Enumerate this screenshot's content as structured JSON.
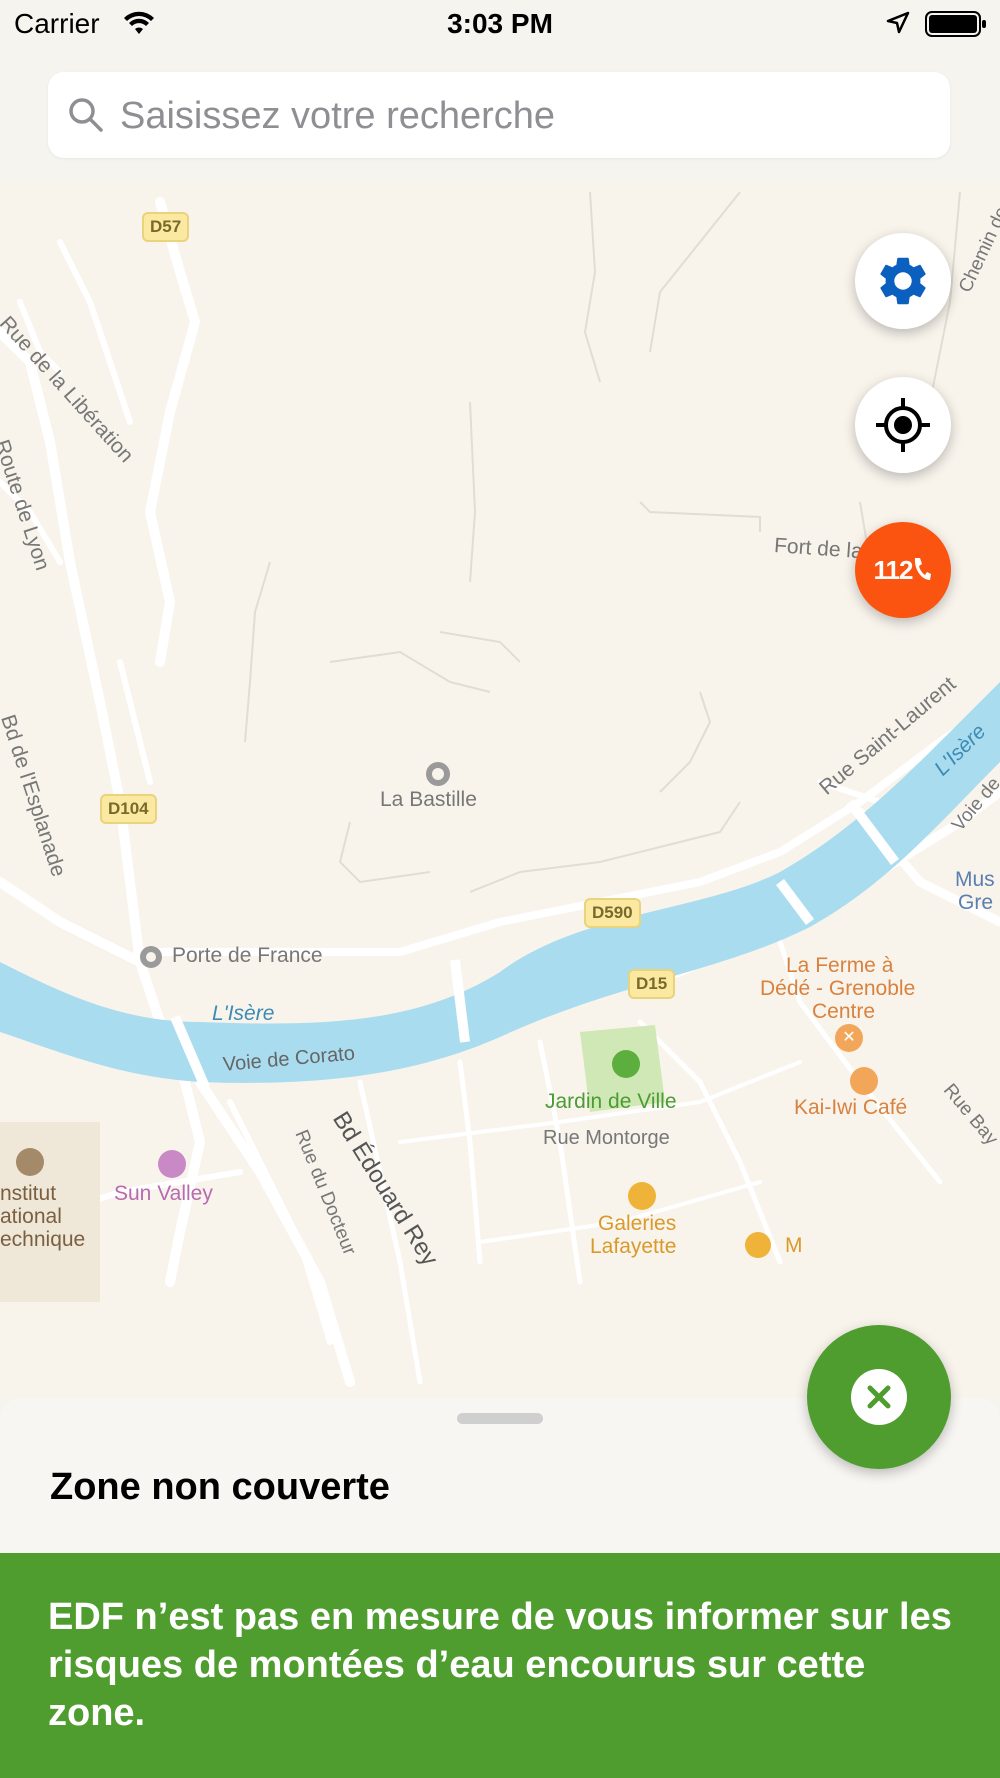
{
  "status_bar": {
    "carrier": "Carrier",
    "time": "3:03 PM"
  },
  "search": {
    "placeholder": "Saisissez votre recherche",
    "value": ""
  },
  "map": {
    "road_shields": [
      "D57",
      "D104",
      "D590",
      "D15"
    ],
    "street_labels": [
      "Rue de la Libération",
      "Route de Lyon",
      "Bd de l'Esplanade",
      "Rue Saint-Laurent",
      "Voie de Corato",
      "Bd Édouard Rey",
      "Rue du Docteur",
      "Rue Montorge",
      "Rue Bay",
      "Voie de",
      "Chemin de"
    ],
    "places": {
      "fort": "Fort de la Bastille",
      "bastille": "La Bastille",
      "porte": "Porte de France",
      "river1": "L'Isère",
      "river2": "L'Isère",
      "ferme_l1": "La Ferme à",
      "ferme_l2": "Dédé - Grenoble",
      "ferme_l3": "Centre",
      "kaiwi": "Kai-Iwi Café",
      "jardin": "Jardin de Ville",
      "galeries_l1": "Galeries",
      "galeries_l2": "Lafayette",
      "sunvalley": "Sun Valley",
      "institut_l1": "nstitut",
      "institut_l2": "ational",
      "institut_l3": "echnique",
      "musee_l1": "Mus",
      "musee_l2": "Gre",
      "m_label": "M"
    }
  },
  "buttons": {
    "settings_icon": "gear-icon",
    "locate_icon": "crosshair-icon",
    "emergency_label": "112",
    "close_icon": "close-icon"
  },
  "sheet": {
    "title": "Zone non couverte"
  },
  "banner": {
    "text": "EDF n’est pas en mesure de vous informer sur les risques de montées d’eau encourus sur cette zone."
  },
  "colors": {
    "accent_blue": "#0a5fbf",
    "emergency_orange": "#fb5410",
    "green": "#509d2f",
    "river": "#a9dcef"
  }
}
